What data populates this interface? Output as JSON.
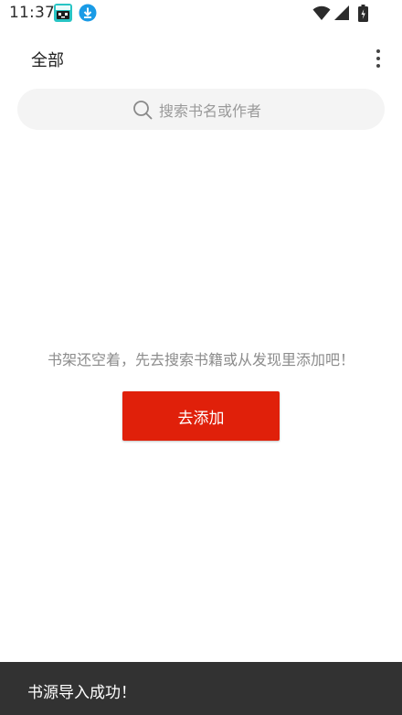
{
  "status_bar": {
    "time": "11:37",
    "icons": [
      "game-notification-icon",
      "download-notification-icon",
      "wifi-icon",
      "cell-signal-icon",
      "battery-icon"
    ],
    "download_icon_color": "#1a9be6"
  },
  "top_bar": {
    "title": "全部",
    "more_icon": "more-vertical-icon"
  },
  "search": {
    "placeholder": "搜索书名或作者",
    "icon": "search-icon"
  },
  "empty_state": {
    "message": "书架还空着，先去搜索书籍或从发现里添加吧！",
    "button_label": "去添加",
    "button_color": "#e0200a"
  },
  "snackbar": {
    "message": "书源导入成功！",
    "background": "#323232"
  }
}
